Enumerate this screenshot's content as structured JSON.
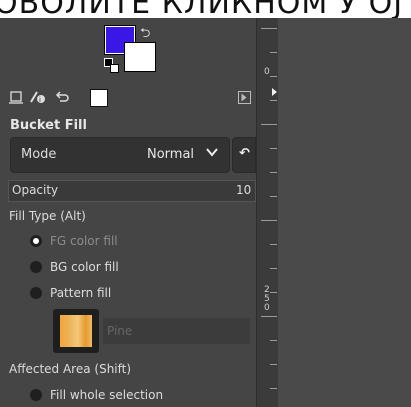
{
  "top_text": "ОВОЛИТЕ КЛИКНОМ У ОЈ",
  "colors": {
    "foreground": "#3a17e6",
    "background": "#ffffff",
    "panel_bg": "#454545"
  },
  "tabs": [
    {
      "icon": "tool-options-icon"
    },
    {
      "icon": "device-status-icon"
    },
    {
      "icon": "undo-history-icon"
    },
    {
      "icon": "images-icon"
    }
  ],
  "tool": {
    "title": "Bucket Fill",
    "mode_label": "Mode",
    "mode_value": "Normal",
    "opacity_label": "Opacity",
    "opacity_value": "10",
    "fill_type_label": "Fill Type  (Alt)",
    "fill_options": [
      {
        "label": "FG color fill",
        "checked": true,
        "dim": true
      },
      {
        "label": "BG color fill",
        "checked": false,
        "dim": false
      },
      {
        "label": "Pattern fill",
        "checked": false,
        "dim": false
      }
    ],
    "pattern_name": "Pine",
    "affected_area_label": "Affected Area  (Shift)",
    "affected_options": [
      {
        "label": "Fill whole selection",
        "checked": false
      }
    ]
  },
  "ruler": {
    "labels": [
      "0",
      "250"
    ]
  }
}
